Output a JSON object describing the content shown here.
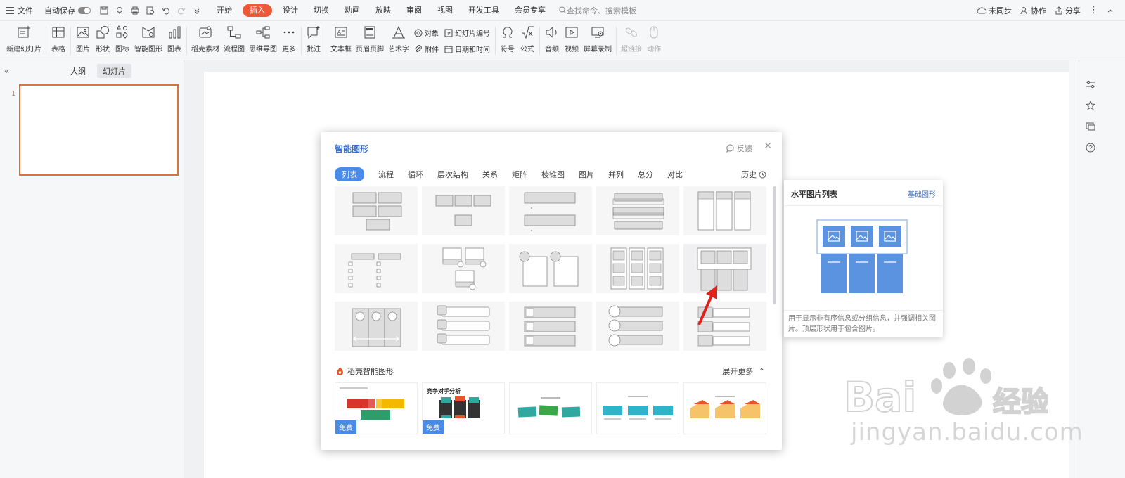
{
  "topbar": {
    "file_label": "文件",
    "autosave_label": "自动保存",
    "tabs": [
      {
        "label": "开始",
        "active": false
      },
      {
        "label": "插入",
        "active": true
      },
      {
        "label": "设计",
        "active": false
      },
      {
        "label": "切换",
        "active": false
      },
      {
        "label": "动画",
        "active": false
      },
      {
        "label": "放映",
        "active": false
      },
      {
        "label": "审阅",
        "active": false
      },
      {
        "label": "视图",
        "active": false
      },
      {
        "label": "开发工具",
        "active": false
      },
      {
        "label": "会员专享",
        "active": false
      }
    ],
    "search_placeholder": "查找命令、搜索模板",
    "sync_label": "未同步",
    "collab_label": "协作",
    "share_label": "分享"
  },
  "ribbon": {
    "new_slide": "新建幻灯片",
    "table": "表格",
    "picture": "图片",
    "shape": "形状",
    "icon": "图标",
    "smartart": "智能图形",
    "chart": "图表",
    "material": "稻壳素材",
    "flowchart": "流程图",
    "mindmap": "思维导图",
    "more": "更多",
    "comment": "批注",
    "textbox": "文本框",
    "header_footer": "页眉页脚",
    "wordart": "艺术字",
    "object": "对象",
    "attachment": "附件",
    "slide_number": "幻灯片编号",
    "datetime": "日期和时间",
    "symbol": "符号",
    "formula": "公式",
    "audio": "音频",
    "video": "视频",
    "screen_record": "屏幕录制",
    "hyperlink": "超链接",
    "action": "动作"
  },
  "left_pane": {
    "outline_tab": "大纲",
    "slides_tab": "幻灯片",
    "slide_number": "1"
  },
  "dialog": {
    "title": "智能图形",
    "feedback": "反馈",
    "categories": [
      "列表",
      "流程",
      "循环",
      "层次结构",
      "关系",
      "矩阵",
      "棱锥图",
      "图片",
      "并列",
      "总分",
      "对比"
    ],
    "history": "历史",
    "section_title": "稻壳智能图形",
    "expand_more": "展开更多",
    "free_badge": "免费",
    "tpl2_title": "竞争对手分析"
  },
  "tooltip": {
    "title": "水平图片列表",
    "link": "基础图形",
    "description": "用于显示非有序信息或分组信息，并强调相关图片。顶层形状用于包含图片。"
  },
  "watermark": {
    "text": "jingyan.baidu.com"
  },
  "colors": {
    "accent_orange": "#ec5a3a",
    "accent_blue": "#4a8ae8",
    "slide_border": "#d9733a",
    "preview_blue": "#5b93e0"
  }
}
